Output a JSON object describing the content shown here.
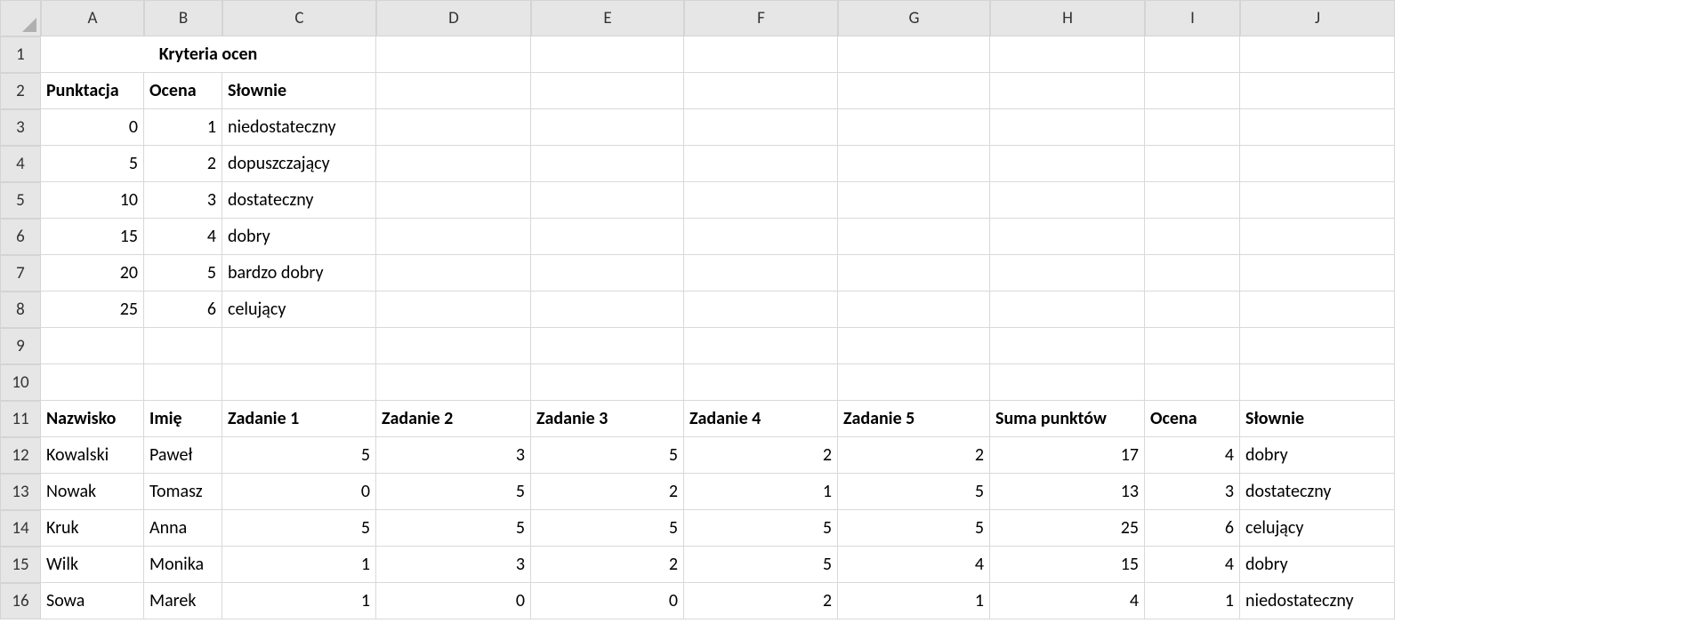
{
  "columns": [
    "A",
    "B",
    "C",
    "D",
    "E",
    "F",
    "G",
    "H",
    "I",
    "J"
  ],
  "rows": [
    "1",
    "2",
    "3",
    "4",
    "5",
    "6",
    "7",
    "8",
    "9",
    "10",
    "11",
    "12",
    "13",
    "14",
    "15",
    "16"
  ],
  "merged_title": "Kryteria ocen",
  "headers1": {
    "A": "Punktacja",
    "B": "Ocena",
    "C": "Słownie"
  },
  "criteria": [
    {
      "pkt": "0",
      "ocena": "1",
      "slownie": "niedostateczny"
    },
    {
      "pkt": "5",
      "ocena": "2",
      "slownie": "dopuszczający"
    },
    {
      "pkt": "10",
      "ocena": "3",
      "slownie": "dostateczny"
    },
    {
      "pkt": "15",
      "ocena": "4",
      "slownie": "dobry"
    },
    {
      "pkt": "20",
      "ocena": "5",
      "slownie": "bardzo dobry"
    },
    {
      "pkt": "25",
      "ocena": "6",
      "slownie": "celujący"
    }
  ],
  "headers2": {
    "A": "Nazwisko",
    "B": "Imię",
    "C": "Zadanie 1",
    "D": "Zadanie 2",
    "E": "Zadanie 3",
    "F": "Zadanie 4",
    "G": "Zadanie 5",
    "H": "Suma punktów",
    "I": "Ocena",
    "J": "Słownie"
  },
  "students": [
    {
      "nazwisko": "Kowalski",
      "imie": "Paweł",
      "z1": "5",
      "z2": "3",
      "z3": "5",
      "z4": "2",
      "z5": "2",
      "suma": "17",
      "ocena": "4",
      "slownie": "dobry"
    },
    {
      "nazwisko": "Nowak",
      "imie": "Tomasz",
      "z1": "0",
      "z2": "5",
      "z3": "2",
      "z4": "1",
      "z5": "5",
      "suma": "13",
      "ocena": "3",
      "slownie": "dostateczny"
    },
    {
      "nazwisko": "Kruk",
      "imie": "Anna",
      "z1": "5",
      "z2": "5",
      "z3": "5",
      "z4": "5",
      "z5": "5",
      "suma": "25",
      "ocena": "6",
      "slownie": "celujący"
    },
    {
      "nazwisko": "Wilk",
      "imie": "Monika",
      "z1": "1",
      "z2": "3",
      "z3": "2",
      "z4": "5",
      "z5": "4",
      "suma": "15",
      "ocena": "4",
      "slownie": "dobry"
    },
    {
      "nazwisko": "Sowa",
      "imie": "Marek",
      "z1": "1",
      "z2": "0",
      "z3": "0",
      "z4": "2",
      "z5": "1",
      "suma": "4",
      "ocena": "1",
      "slownie": "niedostateczny"
    }
  ]
}
